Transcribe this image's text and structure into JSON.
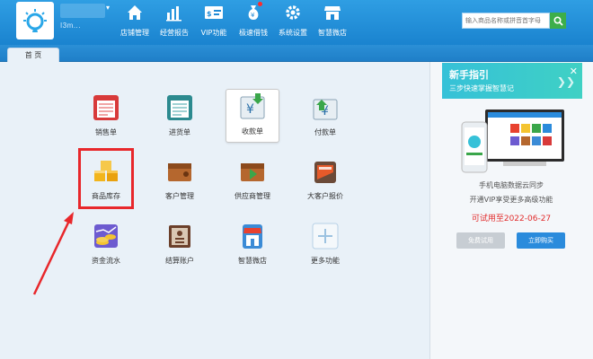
{
  "header": {
    "user_name": "I3m...",
    "nav": [
      {
        "label": "店铺管理",
        "icon": "home-icon"
      },
      {
        "label": "经营报告",
        "icon": "bar-chart-icon"
      },
      {
        "label": "VIP功能",
        "icon": "vip-card-icon"
      },
      {
        "label": "极速借钱",
        "icon": "money-bag-icon"
      },
      {
        "label": "系统设置",
        "icon": "gear-icon"
      },
      {
        "label": "智慧微店",
        "icon": "shop-icon"
      }
    ],
    "search_placeholder": "输入商品名称或拼音首字母"
  },
  "tabs": [
    {
      "label": "首 页"
    }
  ],
  "grid": [
    {
      "label": "销售单",
      "icon": "sales-order-icon"
    },
    {
      "label": "进货单",
      "icon": "purchase-order-icon"
    },
    {
      "label": "收款单",
      "icon": "receipt-icon"
    },
    {
      "label": "付款单",
      "icon": "payment-icon"
    },
    {
      "label": "商品库存",
      "icon": "inventory-icon"
    },
    {
      "label": "客户管理",
      "icon": "customer-icon"
    },
    {
      "label": "供应商管理",
      "icon": "supplier-icon"
    },
    {
      "label": "大客户报价",
      "icon": "quote-icon"
    },
    {
      "label": "资金流水",
      "icon": "cash-flow-icon"
    },
    {
      "label": "结算账户",
      "icon": "account-icon"
    },
    {
      "label": "智慧微店",
      "icon": "micro-shop-icon"
    },
    {
      "label": "更多功能",
      "icon": "plus-icon"
    }
  ],
  "side": {
    "title": "新手指引",
    "subtitle": "三步快速掌握智慧记",
    "line1": "手机电脑数据云同步",
    "line2": "开通VIP享受更多高级功能",
    "trial": "可试用至2022-06-27",
    "free_button": "免费试用",
    "buy_button": "立即购买"
  },
  "colors": {
    "header": "#1f8ad6",
    "highlight": "#e8272b",
    "trial": "#e22c2c",
    "buy": "#2a8bdc"
  }
}
